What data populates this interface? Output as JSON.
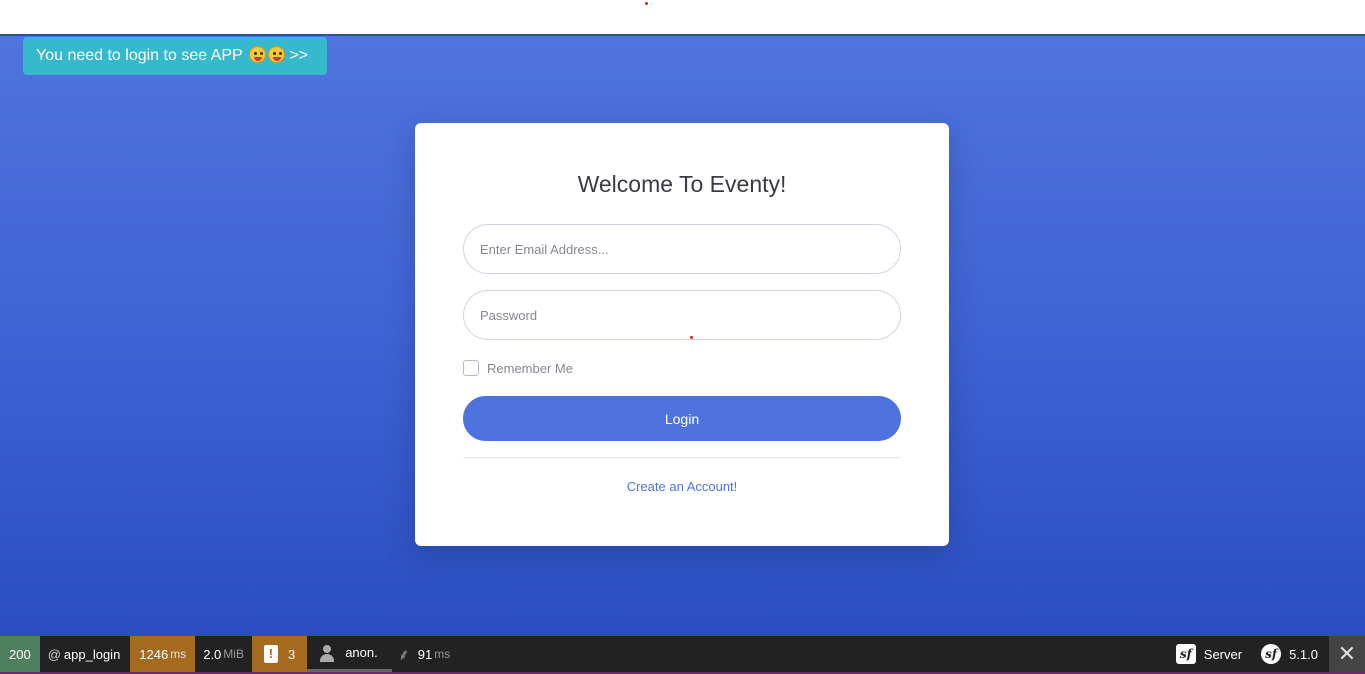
{
  "hint": {
    "text": "You need to login to see APP",
    "suffix": ">>"
  },
  "card": {
    "title": "Welcome To Eventy!",
    "email_placeholder": "Enter Email Address...",
    "password_placeholder": "Password",
    "remember_label": "Remember Me",
    "login_label": "Login",
    "create_account_label": "Create an Account!"
  },
  "toolbar": {
    "status_code": "200",
    "route_prefix": "@",
    "route": "app_login",
    "time_value": "1246",
    "time_unit": "ms",
    "memory_value": "2.0",
    "memory_unit": "MiB",
    "log_count": "3",
    "user": "anon.",
    "twig_time": "91",
    "twig_unit": "ms",
    "server_label": "Server",
    "symfony_version": "5.1.0"
  },
  "icons": {
    "emoji": "face-with-tongue-icon",
    "log": "warning-icon",
    "user": "person-icon",
    "twig": "twig-icon",
    "symfony": "symfony-logo-icon",
    "close": "close-icon"
  },
  "colors": {
    "primary": "#4e73df",
    "info": "#36b9cc",
    "status_ok": "#4f805d",
    "toolbar_warning": "#a46a1f",
    "toolbar_bg": "#222222"
  }
}
